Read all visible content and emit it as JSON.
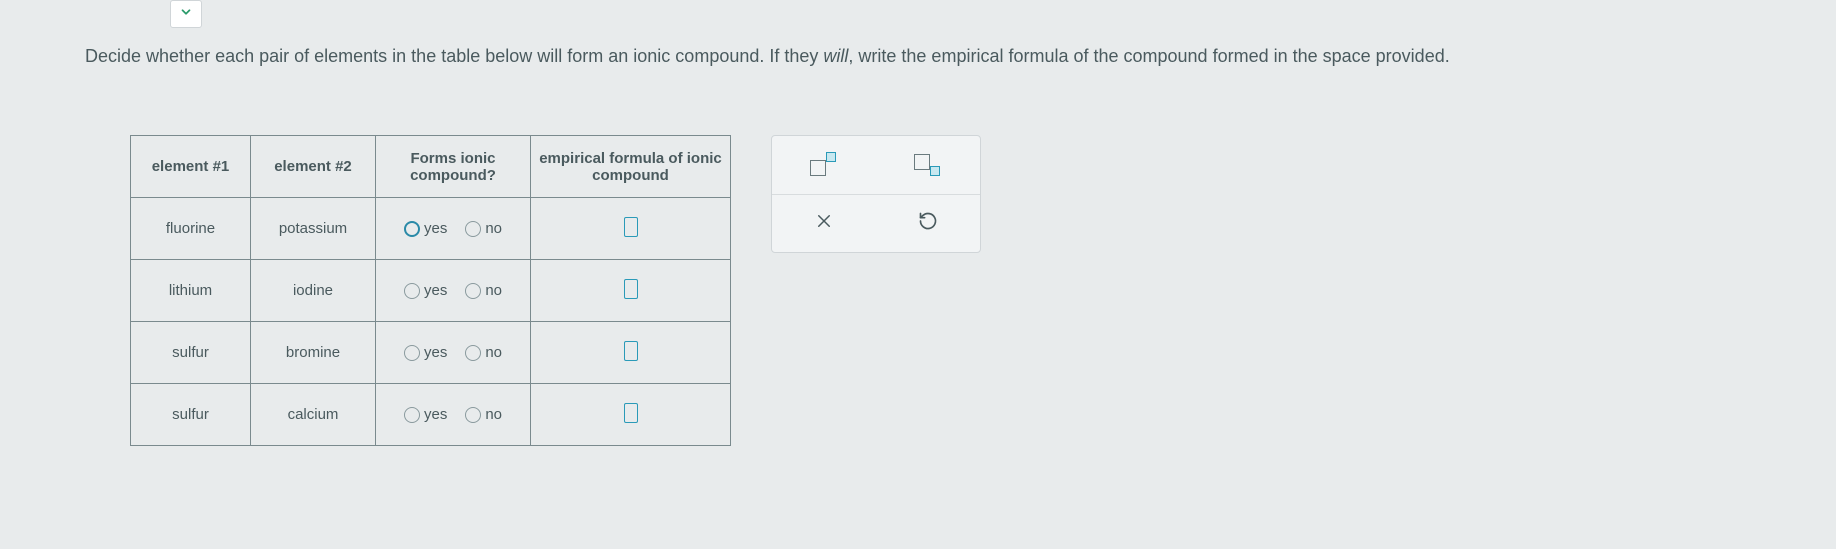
{
  "instructions": {
    "prefix": "Decide whether each pair of elements in the table below will form an ionic compound. If they ",
    "italic": "will",
    "suffix": ", write the empirical formula of the compound formed in the space provided."
  },
  "table": {
    "headers": {
      "col1": "element #1",
      "col2": "element #2",
      "col3": "Forms ionic compound?",
      "col4": "empirical formula of ionic compound"
    },
    "labels": {
      "yes": "yes",
      "no": "no"
    },
    "rows": [
      {
        "e1": "fluorine",
        "e2": "potassium",
        "selected": "yes"
      },
      {
        "e1": "lithium",
        "e2": "iodine",
        "selected": ""
      },
      {
        "e1": "sulfur",
        "e2": "bromine",
        "selected": ""
      },
      {
        "e1": "sulfur",
        "e2": "calcium",
        "selected": ""
      }
    ]
  }
}
